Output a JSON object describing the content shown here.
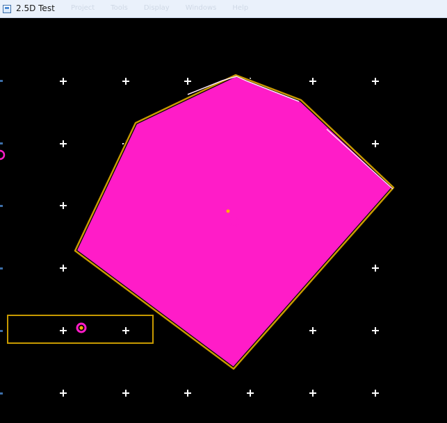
{
  "window": {
    "title": "2.5D Test"
  },
  "ghost_menu": {
    "items": [
      "Project",
      "Tools",
      "Display",
      "Windows",
      "Help"
    ]
  },
  "scene": {
    "background_color": "#000000",
    "grid_color": "#ffffff",
    "polygon_fill": "#ff1cc8",
    "outline_color": "#c89a00",
    "marker_color": "#ff1cc8",
    "accent_color": "#ffb000"
  }
}
